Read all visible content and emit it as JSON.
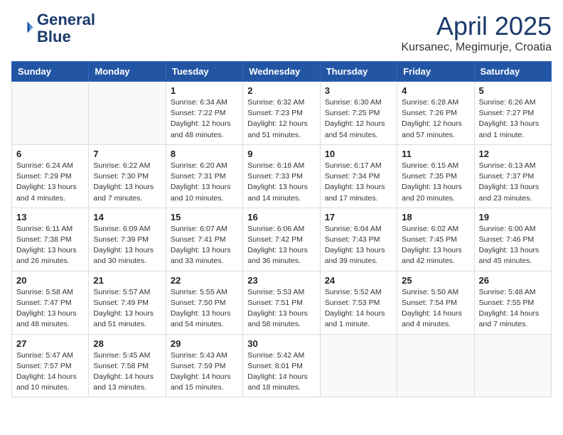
{
  "logo": {
    "line1": "General",
    "line2": "Blue"
  },
  "title": "April 2025",
  "location": "Kursanec, Megimurje, Croatia",
  "days_header": [
    "Sunday",
    "Monday",
    "Tuesday",
    "Wednesday",
    "Thursday",
    "Friday",
    "Saturday"
  ],
  "weeks": [
    [
      {
        "day": "",
        "info": ""
      },
      {
        "day": "",
        "info": ""
      },
      {
        "day": "1",
        "info": "Sunrise: 6:34 AM\nSunset: 7:22 PM\nDaylight: 12 hours\nand 48 minutes."
      },
      {
        "day": "2",
        "info": "Sunrise: 6:32 AM\nSunset: 7:23 PM\nDaylight: 12 hours\nand 51 minutes."
      },
      {
        "day": "3",
        "info": "Sunrise: 6:30 AM\nSunset: 7:25 PM\nDaylight: 12 hours\nand 54 minutes."
      },
      {
        "day": "4",
        "info": "Sunrise: 6:28 AM\nSunset: 7:26 PM\nDaylight: 12 hours\nand 57 minutes."
      },
      {
        "day": "5",
        "info": "Sunrise: 6:26 AM\nSunset: 7:27 PM\nDaylight: 13 hours\nand 1 minute."
      }
    ],
    [
      {
        "day": "6",
        "info": "Sunrise: 6:24 AM\nSunset: 7:29 PM\nDaylight: 13 hours\nand 4 minutes."
      },
      {
        "day": "7",
        "info": "Sunrise: 6:22 AM\nSunset: 7:30 PM\nDaylight: 13 hours\nand 7 minutes."
      },
      {
        "day": "8",
        "info": "Sunrise: 6:20 AM\nSunset: 7:31 PM\nDaylight: 13 hours\nand 10 minutes."
      },
      {
        "day": "9",
        "info": "Sunrise: 6:18 AM\nSunset: 7:33 PM\nDaylight: 13 hours\nand 14 minutes."
      },
      {
        "day": "10",
        "info": "Sunrise: 6:17 AM\nSunset: 7:34 PM\nDaylight: 13 hours\nand 17 minutes."
      },
      {
        "day": "11",
        "info": "Sunrise: 6:15 AM\nSunset: 7:35 PM\nDaylight: 13 hours\nand 20 minutes."
      },
      {
        "day": "12",
        "info": "Sunrise: 6:13 AM\nSunset: 7:37 PM\nDaylight: 13 hours\nand 23 minutes."
      }
    ],
    [
      {
        "day": "13",
        "info": "Sunrise: 6:11 AM\nSunset: 7:38 PM\nDaylight: 13 hours\nand 26 minutes."
      },
      {
        "day": "14",
        "info": "Sunrise: 6:09 AM\nSunset: 7:39 PM\nDaylight: 13 hours\nand 30 minutes."
      },
      {
        "day": "15",
        "info": "Sunrise: 6:07 AM\nSunset: 7:41 PM\nDaylight: 13 hours\nand 33 minutes."
      },
      {
        "day": "16",
        "info": "Sunrise: 6:06 AM\nSunset: 7:42 PM\nDaylight: 13 hours\nand 36 minutes."
      },
      {
        "day": "17",
        "info": "Sunrise: 6:04 AM\nSunset: 7:43 PM\nDaylight: 13 hours\nand 39 minutes."
      },
      {
        "day": "18",
        "info": "Sunrise: 6:02 AM\nSunset: 7:45 PM\nDaylight: 13 hours\nand 42 minutes."
      },
      {
        "day": "19",
        "info": "Sunrise: 6:00 AM\nSunset: 7:46 PM\nDaylight: 13 hours\nand 45 minutes."
      }
    ],
    [
      {
        "day": "20",
        "info": "Sunrise: 5:58 AM\nSunset: 7:47 PM\nDaylight: 13 hours\nand 48 minutes."
      },
      {
        "day": "21",
        "info": "Sunrise: 5:57 AM\nSunset: 7:49 PM\nDaylight: 13 hours\nand 51 minutes."
      },
      {
        "day": "22",
        "info": "Sunrise: 5:55 AM\nSunset: 7:50 PM\nDaylight: 13 hours\nand 54 minutes."
      },
      {
        "day": "23",
        "info": "Sunrise: 5:53 AM\nSunset: 7:51 PM\nDaylight: 13 hours\nand 58 minutes."
      },
      {
        "day": "24",
        "info": "Sunrise: 5:52 AM\nSunset: 7:53 PM\nDaylight: 14 hours\nand 1 minute."
      },
      {
        "day": "25",
        "info": "Sunrise: 5:50 AM\nSunset: 7:54 PM\nDaylight: 14 hours\nand 4 minutes."
      },
      {
        "day": "26",
        "info": "Sunrise: 5:48 AM\nSunset: 7:55 PM\nDaylight: 14 hours\nand 7 minutes."
      }
    ],
    [
      {
        "day": "27",
        "info": "Sunrise: 5:47 AM\nSunset: 7:57 PM\nDaylight: 14 hours\nand 10 minutes."
      },
      {
        "day": "28",
        "info": "Sunrise: 5:45 AM\nSunset: 7:58 PM\nDaylight: 14 hours\nand 13 minutes."
      },
      {
        "day": "29",
        "info": "Sunrise: 5:43 AM\nSunset: 7:59 PM\nDaylight: 14 hours\nand 15 minutes."
      },
      {
        "day": "30",
        "info": "Sunrise: 5:42 AM\nSunset: 8:01 PM\nDaylight: 14 hours\nand 18 minutes."
      },
      {
        "day": "",
        "info": ""
      },
      {
        "day": "",
        "info": ""
      },
      {
        "day": "",
        "info": ""
      }
    ]
  ]
}
